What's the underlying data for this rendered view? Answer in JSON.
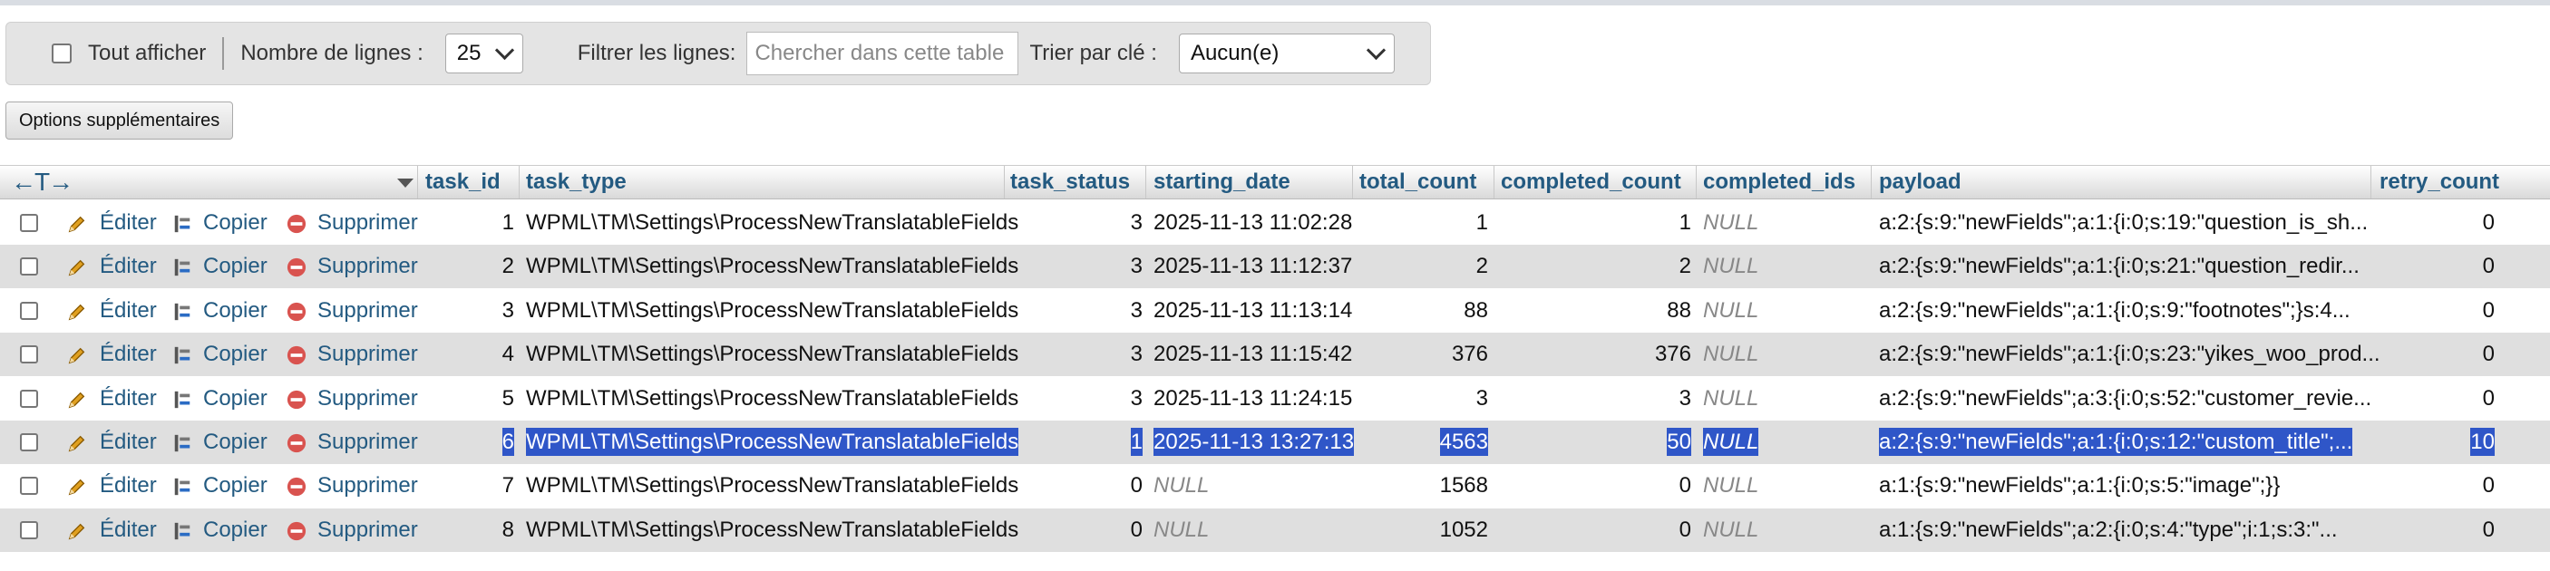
{
  "filter_bar": {
    "show_all_label": "Tout afficher",
    "rows_label": "Nombre de lignes :",
    "rows_value": "25",
    "filter_label": "Filtrer les lignes:",
    "filter_placeholder": "Chercher dans cette table",
    "sort_label": "Trier par clé :",
    "sort_value": "Aucun(e)"
  },
  "options_button": "Options supplémentaires",
  "table": {
    "nav_arrows": "←T→",
    "columns": [
      "task_id",
      "task_type",
      "task_status",
      "starting_date",
      "total_count",
      "completed_count",
      "completed_ids",
      "payload",
      "retry_count"
    ],
    "actions": {
      "edit": "Éditer",
      "copy": "Copier",
      "delete": "Supprimer"
    },
    "rows": [
      {
        "task_id": "1",
        "task_type": "WPML\\TM\\Settings\\ProcessNewTranslatableFields",
        "task_status": "3",
        "starting_date": "2025-11-13 11:02:28",
        "total_count": "1",
        "completed_count": "1",
        "completed_ids": "NULL",
        "payload": "a:2:{s:9:\"newFields\";a:1:{i:0;s:19:\"question_is_sh...",
        "retry_count": "0",
        "selected": false
      },
      {
        "task_id": "2",
        "task_type": "WPML\\TM\\Settings\\ProcessNewTranslatableFields",
        "task_status": "3",
        "starting_date": "2025-11-13 11:12:37",
        "total_count": "2",
        "completed_count": "2",
        "completed_ids": "NULL",
        "payload": "a:2:{s:9:\"newFields\";a:1:{i:0;s:21:\"question_redir...",
        "retry_count": "0",
        "selected": false
      },
      {
        "task_id": "3",
        "task_type": "WPML\\TM\\Settings\\ProcessNewTranslatableFields",
        "task_status": "3",
        "starting_date": "2025-11-13 11:13:14",
        "total_count": "88",
        "completed_count": "88",
        "completed_ids": "NULL",
        "payload": "a:2:{s:9:\"newFields\";a:1:{i:0;s:9:\"footnotes\";}s:4...",
        "retry_count": "0",
        "selected": false
      },
      {
        "task_id": "4",
        "task_type": "WPML\\TM\\Settings\\ProcessNewTranslatableFields",
        "task_status": "3",
        "starting_date": "2025-11-13 11:15:42",
        "total_count": "376",
        "completed_count": "376",
        "completed_ids": "NULL",
        "payload": "a:2:{s:9:\"newFields\";a:1:{i:0;s:23:\"yikes_woo_prod...",
        "retry_count": "0",
        "selected": false
      },
      {
        "task_id": "5",
        "task_type": "WPML\\TM\\Settings\\ProcessNewTranslatableFields",
        "task_status": "3",
        "starting_date": "2025-11-13 11:24:15",
        "total_count": "3",
        "completed_count": "3",
        "completed_ids": "NULL",
        "payload": "a:2:{s:9:\"newFields\";a:3:{i:0;s:52:\"customer_revie...",
        "retry_count": "0",
        "selected": false
      },
      {
        "task_id": "6",
        "task_type": "WPML\\TM\\Settings\\ProcessNewTranslatableFields",
        "task_status": "1",
        "starting_date": "2025-11-13 13:27:13",
        "total_count": "4563",
        "completed_count": "50",
        "completed_ids": "NULL",
        "payload": "a:2:{s:9:\"newFields\";a:1:{i:0;s:12:\"custom_title\";...",
        "retry_count": "10",
        "selected": true
      },
      {
        "task_id": "7",
        "task_type": "WPML\\TM\\Settings\\ProcessNewTranslatableFields",
        "task_status": "0",
        "starting_date": "NULL",
        "total_count": "1568",
        "completed_count": "0",
        "completed_ids": "NULL",
        "payload": "a:1:{s:9:\"newFields\";a:1:{i:0;s:5:\"image\";}}",
        "retry_count": "0",
        "selected": false
      },
      {
        "task_id": "8",
        "task_type": "WPML\\TM\\Settings\\ProcessNewTranslatableFields",
        "task_status": "0",
        "starting_date": "NULL",
        "total_count": "1052",
        "completed_count": "0",
        "completed_ids": "NULL",
        "payload": "a:1:{s:9:\"newFields\";a:2:{i:0;s:4:\"type\";i:1;s:3:\"...",
        "retry_count": "0",
        "selected": false
      }
    ]
  },
  "colors": {
    "link": "#235a81",
    "selection": "#2f56c8",
    "row_alt": "#dfdfdf",
    "delete_icon": "#d9534f",
    "edit_icon": "#e0a020"
  }
}
